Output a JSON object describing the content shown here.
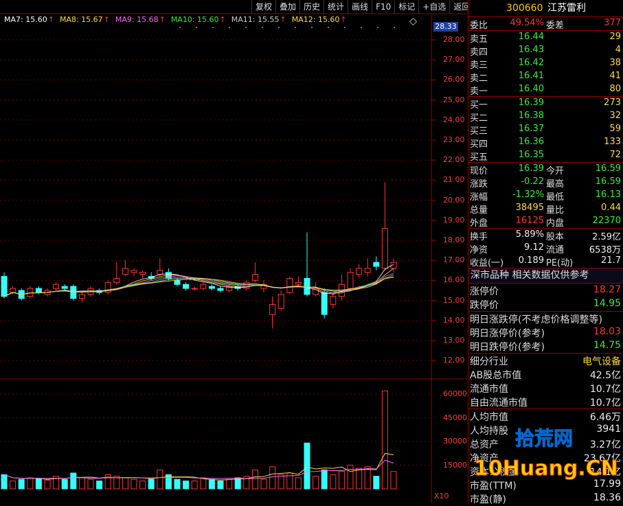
{
  "toolbar": [
    "复权",
    "叠加",
    "历史",
    "统计",
    "画线",
    "F10",
    "标记",
    "+自选",
    "返回"
  ],
  "ma_line": [
    {
      "label": "MA7: 15.60",
      "color": "#ffffff"
    },
    {
      "label": "MA8: 15.67",
      "color": "#ffdd33"
    },
    {
      "label": "MA9: 15.68",
      "color": "#ff66ff"
    },
    {
      "label": "MA10: 15.60",
      "color": "#33ee33"
    },
    {
      "label": "MA11: 15.55",
      "color": "#cccccc"
    },
    {
      "label": "MA12: 15.60",
      "color": "#ffdd33"
    }
  ],
  "chart": {
    "current_price_tag": "28.33",
    "price_axis": [
      "28.00",
      "27.00",
      "26.00",
      "25.00",
      "24.00",
      "23.00",
      "22.00",
      "21.00",
      "20.00",
      "19.00",
      "18.00",
      "17.00",
      "16.00",
      "15.00",
      "14.00",
      "13.00",
      "12.00"
    ],
    "volume_axis": [
      "60000",
      "45000",
      "30000",
      "15000"
    ],
    "volume_unit": "X10"
  },
  "stock": {
    "code": "300660",
    "name": "江苏雷利"
  },
  "order_ratio": {
    "l1": "委比",
    "v1": "49.54%",
    "l2": "委差",
    "v2": "377"
  },
  "asks": [
    {
      "label": "卖五",
      "price": "16.44",
      "vol": "29"
    },
    {
      "label": "卖四",
      "price": "16.43",
      "vol": "4"
    },
    {
      "label": "卖三",
      "price": "16.42",
      "vol": "38"
    },
    {
      "label": "卖二",
      "price": "16.41",
      "vol": "41"
    },
    {
      "label": "卖一",
      "price": "16.40",
      "vol": "80"
    }
  ],
  "bids": [
    {
      "label": "买一",
      "price": "16.39",
      "vol": "273"
    },
    {
      "label": "买二",
      "price": "16.38",
      "vol": "32"
    },
    {
      "label": "买三",
      "price": "16.37",
      "vol": "59"
    },
    {
      "label": "买四",
      "price": "16.36",
      "vol": "133"
    },
    {
      "label": "买五",
      "price": "16.35",
      "vol": "72"
    }
  ],
  "quote": [
    {
      "l1": "现价",
      "v1": "16.39",
      "c1": "grn",
      "l2": "今开",
      "v2": "16.59",
      "c2": "grn"
    },
    {
      "l1": "涨跌",
      "v1": "-0.22",
      "c1": "grn",
      "l2": "最高",
      "v2": "16.59",
      "c2": "grn"
    },
    {
      "l1": "涨幅",
      "v1": "-1.32%",
      "c1": "grn",
      "l2": "最低",
      "v2": "16.13",
      "c2": "grn"
    },
    {
      "l1": "总量",
      "v1": "38495",
      "c1": "yel",
      "l2": "量比",
      "v2": "0.44",
      "c2": "yel"
    },
    {
      "l1": "外盘",
      "v1": "16125",
      "c1": "red",
      "l2": "内盘",
      "v2": "22370",
      "c2": "grn"
    }
  ],
  "finance": [
    {
      "l1": "换手",
      "v1": "5.89%",
      "l2": "股本",
      "v2": "2.59亿"
    },
    {
      "l1": "净资",
      "v1": "9.12",
      "l2": "流通",
      "v2": "6538万"
    },
    {
      "l1": "收益(一)",
      "v1": "0.189",
      "l2": "PE(动)",
      "v2": "21.7"
    }
  ],
  "band": {
    "text": "深市品种  相关数据仅供参考"
  },
  "limits": [
    {
      "label": "涨停价",
      "value": "18.27",
      "cls": "red"
    },
    {
      "label": "跌停价",
      "value": "14.95",
      "cls": "grn"
    }
  ],
  "tomorrow": [
    {
      "label": "明日涨跌停(不考虑价格调整等)",
      "value": "",
      "cls": "wht"
    },
    {
      "label": "明日涨停价(参考)",
      "value": "18.03",
      "cls": "red"
    },
    {
      "label": "明日跌停价(参考)",
      "value": "14.75",
      "cls": "grn"
    }
  ],
  "industry": {
    "label": "细分行业",
    "value": "电气设备"
  },
  "market": [
    {
      "label": "AB股总市值",
      "value": "42.5亿"
    },
    {
      "label": "流通市值",
      "value": "10.7亿"
    },
    {
      "label": "自由流通市值",
      "value": "10.7亿"
    }
  ],
  "holders": [
    {
      "label": "人均市值",
      "value": "6.46万"
    },
    {
      "label": "人均持股",
      "value": "3941"
    },
    {
      "label": "总资产",
      "value": "3.27亿"
    },
    {
      "label": "净资产",
      "value": "23.67亿"
    },
    {
      "label": "资本公积金",
      "value": "14.1亿"
    },
    {
      "label": "市盈(TTM)",
      "value": "17.99"
    },
    {
      "label": "市盈(静)",
      "value": "18.36"
    }
  ],
  "watermark": {
    "top": "拾荒网",
    "bottom": "10Huang.CN"
  },
  "colors": {
    "up": "#ff3333",
    "down": "#33ffff",
    "border": "#9a0000"
  }
}
